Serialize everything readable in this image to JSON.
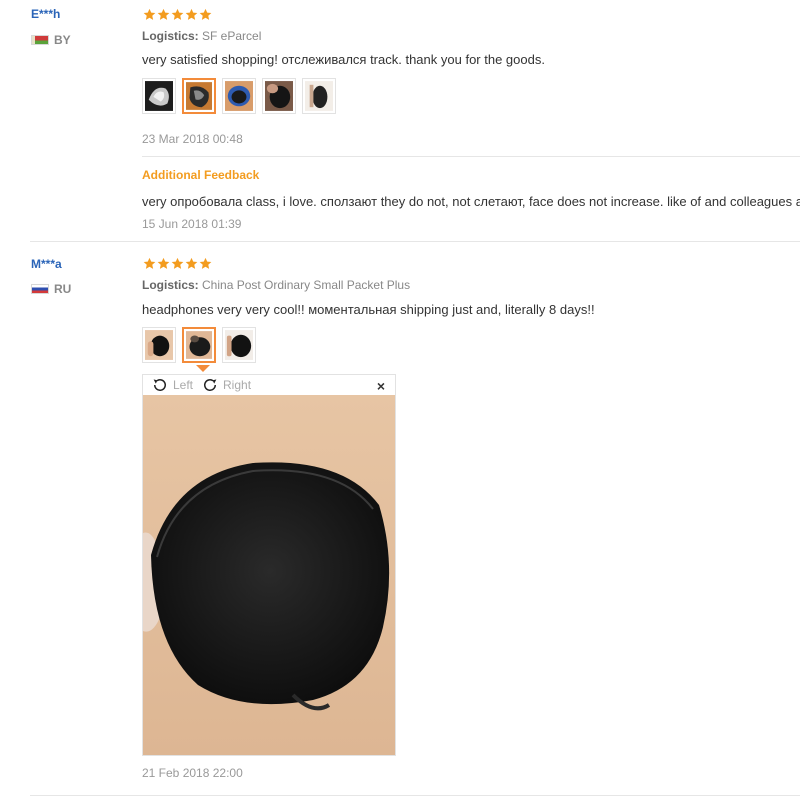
{
  "reviews": [
    {
      "name": "E***h",
      "country_code": "BY",
      "rating": 5,
      "logistics_label": "Logistics:",
      "logistics_value": "SF eParcel",
      "text": "very satisfied shopping! отслеживался track. thank you for the goods.",
      "date": "23 Mar 2018 00:48",
      "additional_feedback_label": "Additional Feedback",
      "additional_feedback_text": "very опробовала class, i love. сползают they do not, not слетают, face does not increase. like of and colleagues also. satisfied",
      "additional_feedback_date": "15 Jun 2018 01:39"
    },
    {
      "name": "M***a",
      "country_code": "RU",
      "rating": 5,
      "logistics_label": "Logistics:",
      "logistics_value": "China Post Ordinary Small Packet Plus",
      "text": "headphones very very cool!! моментальная shipping just and, literally 8 days!!",
      "date": "21 Feb 2018 22:00"
    }
  ],
  "viewer": {
    "rotate_left_label": "Left",
    "rotate_right_label": "Right",
    "close_glyph": "×"
  },
  "colors": {
    "name": "#2a64b8",
    "star": "#f39c1f",
    "active_thumb_border": "#f38b3a",
    "additional_feedback": "#f39c1f"
  }
}
